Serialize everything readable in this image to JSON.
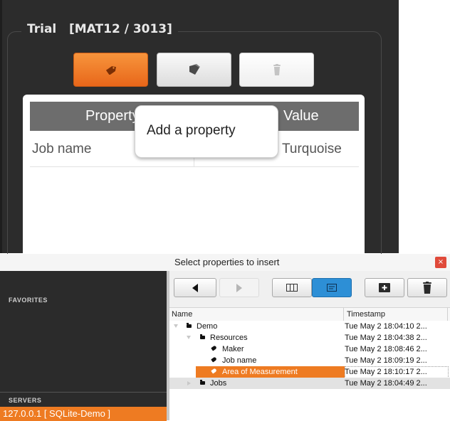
{
  "trial": {
    "title": "Trial   [MAT12 / 3013]",
    "buttons": [
      {
        "name": "add-property",
        "icon": "tag-icon"
      },
      {
        "name": "add-multiple",
        "icon": "tags-icon"
      },
      {
        "name": "delete",
        "icon": "trash-icon"
      }
    ],
    "table": {
      "headers": [
        "Property",
        "Value"
      ],
      "rows": [
        {
          "property": "Job name",
          "value": "Turquoise"
        }
      ]
    },
    "tooltip": "Add a property"
  },
  "dialog": {
    "title": "Select properties to insert",
    "close_icon": "×",
    "sidebar": {
      "favorites_header": "FAVORITES",
      "servers_header": "SERVERS",
      "servers": [
        "127.0.0.1 [ SQLite-Demo ]"
      ]
    },
    "toolbar": [
      "back-arrow-icon",
      "forward-arrow-icon",
      "columns-view-icon",
      "list-view-icon",
      "add-folder-icon",
      "trash-icon"
    ],
    "columns": {
      "name": "Name",
      "timestamp": "Timestamp"
    },
    "tree": [
      {
        "name": "Demo",
        "timestamp": "Tue May 2 18:04:10 2...",
        "level": 0,
        "type": "folder",
        "arrow": "down"
      },
      {
        "name": "Resources",
        "timestamp": "Tue May 2 18:04:38 2...",
        "level": 1,
        "type": "folder",
        "arrow": "down"
      },
      {
        "name": "Maker",
        "timestamp": "Tue May 2 18:08:46 2...",
        "level": 2,
        "type": "tag"
      },
      {
        "name": "Job name",
        "timestamp": "Tue May 2 18:09:19 2...",
        "level": 2,
        "type": "tag"
      },
      {
        "name": "Area of Measurement",
        "timestamp": "Tue May 2 18:10:17 2...",
        "level": 2,
        "type": "tag",
        "selected": true
      },
      {
        "name": "Jobs",
        "timestamp": "Tue May 2 18:04:49 2...",
        "level": 1,
        "type": "folder",
        "arrow": "right"
      }
    ]
  },
  "colors": {
    "accent": "#ee7b22",
    "active": "#2d8fd6",
    "dark_panel": "#2c2c2c"
  }
}
